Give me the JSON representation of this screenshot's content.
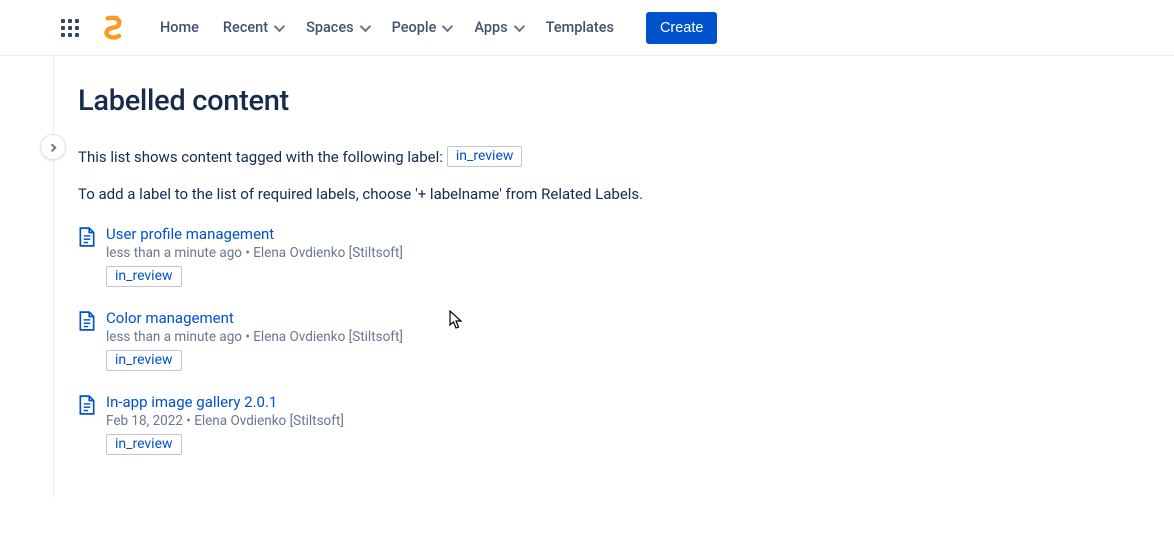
{
  "nav": {
    "home": "Home",
    "recent": "Recent",
    "spaces": "Spaces",
    "people": "People",
    "apps": "Apps",
    "templates": "Templates",
    "create": "Create"
  },
  "page": {
    "title": "Labelled content",
    "intro_prefix": "This list shows content tagged with the following label:",
    "intro_label": "in_review",
    "help": "To add a label to the list of required labels, choose '+ labelname' from Related Labels."
  },
  "results": [
    {
      "title": "User profile management",
      "meta": "less than a minute ago • Elena Ovdienko [Stiltsoft]",
      "label": "in_review"
    },
    {
      "title": "Color management",
      "meta": "less than a minute ago • Elena Ovdienko [Stiltsoft]",
      "label": "in_review"
    },
    {
      "title": "In-app image gallery 2.0.1",
      "meta": "Feb 18, 2022 • Elena Ovdienko [Stiltsoft]",
      "label": "in_review"
    }
  ]
}
